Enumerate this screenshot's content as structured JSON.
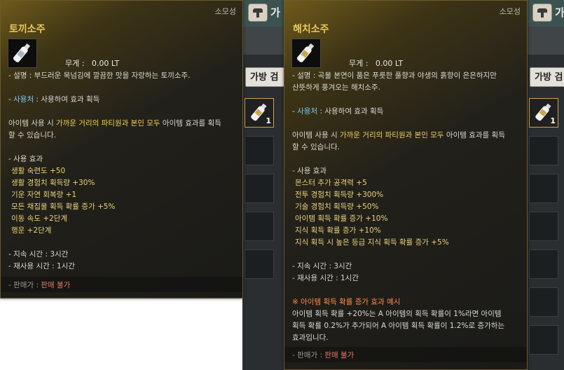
{
  "background": {
    "top_tab_text": "가",
    "bag_button_label": "가방 검",
    "slot_count": "1"
  },
  "tooltip_left": {
    "category": "소모성",
    "name": "토끼소주",
    "weight": "무게 :   0.00 LT",
    "description": "- 설명 : 부드러운 목넘김에 깔끔한 맛을 자랑하는 토끼소주.",
    "usage_prefix": "- ",
    "usage_label": "사용처",
    "usage_text": " : 사용하여 효과 획득",
    "usage_note_1a": "아이템 사용 시 ",
    "usage_note_1b": "가까운 거리의 파티원과 본인 모두",
    "usage_note_1c": " 아이템 효과를 획득",
    "usage_note_2": "할 수 있습니다.",
    "effects_header": "- 사용 효과",
    "effects": [
      "생활 숙련도 +50",
      "생활 경험치 획득량 +30%",
      "기운 자연 회복량 +1",
      "모든 채집물 획득 확률 증가 +5%",
      "이동 속도 +2단계",
      "행운 +2단계"
    ],
    "duration": "- 지속 시간 : 3시간",
    "cooldown": "- 재사용 시간 : 1시간",
    "sell_label": "- 판매가 : ",
    "sell_value": "판매 불가"
  },
  "tooltip_right": {
    "category": "소모성",
    "name": "해치소주",
    "weight": "무게 :   0.00 LT",
    "description_1": "- 설명 : 곡물 본연이 품은 푸릇한 풀향과 야생의 흙향이 은은하지만",
    "description_2": "산뜻하게 풍겨오는 해치소주.",
    "usage_prefix": "- ",
    "usage_label": "사용처",
    "usage_text": " : 사용하여 효과 획득",
    "usage_note_1a": "아이템 사용 시 ",
    "usage_note_1b": "가까운 거리의 파티원과 본인 모두",
    "usage_note_1c": " 아이템 효과를 획득",
    "usage_note_2": "할 수 있습니다.",
    "effects_header": "- 사용 효과",
    "effects": [
      "몬스터 추가 공격력 +5",
      "전투 경험치 획득량 +300%",
      "기술 경험치 획득량 +50%",
      "아이템 획득 확률 증가 +10%",
      "지식 획득 확률 증가 +10%",
      "지식 획득 시 높은 등급 지식 획득 확률 증가 +5%"
    ],
    "duration": "- 지속 시간 : 3시간",
    "cooldown": "- 재사용 시간 : 1시간",
    "example_title": "※ 아이템 획득 확률 증가 효과 예시",
    "example_1": "아이템 획득 확률 +20%는 A 아이템의 획득 확률이 1%라면 아이템",
    "example_2": "획득 확률 0.2%가 추가되어 A 아이템 획득 확률이 1.2%로 증가하는",
    "example_3": "효과입니다.",
    "sell_label": "- 판매가 : ",
    "sell_value": "판매 불가"
  },
  "colors": {
    "name": "#e8c760",
    "usage_label": "#7cc8ee",
    "highlight": "#f0d060",
    "sell_value": "#e07a6a"
  },
  "icons": [
    "bottle-icon",
    "inventory-tab-icon"
  ]
}
